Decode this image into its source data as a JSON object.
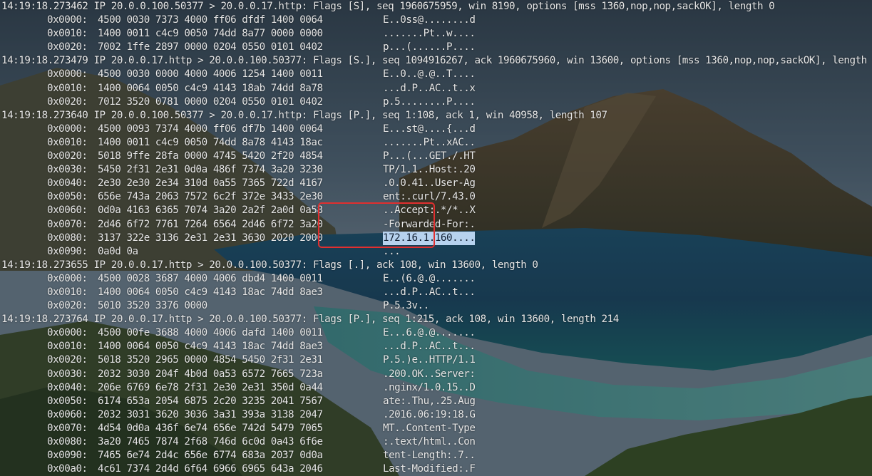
{
  "colors": {
    "text": "#e6e6e6",
    "selection": "#b7d2ee",
    "annotation_box": "#e12f2f"
  },
  "terminal": {
    "lines": [
      {
        "kind": "header",
        "text": "14:19:18.273462 IP 20.0.0.100.50377 > 20.0.0.17.http: Flags [S], seq 1960675959, win 8190, options [mss 1360,nop,nop,sackOK], length 0"
      },
      {
        "kind": "hex",
        "offset": "0x0000:",
        "words": "4500 0030 7373 4000 ff06 dfdf 1400 0064",
        "ascii": "E..0ss@........d"
      },
      {
        "kind": "hex",
        "offset": "0x0010:",
        "words": "1400 0011 c4c9 0050 74dd 8a77 0000 0000",
        "ascii": ".......Pt..w...."
      },
      {
        "kind": "hex",
        "offset": "0x0020:",
        "words": "7002 1ffe 2897 0000 0204 0550 0101 0402",
        "ascii": "p...(......P...."
      },
      {
        "kind": "header",
        "text": "14:19:18.273479 IP 20.0.0.17.http > 20.0.0.100.50377: Flags [S.], seq 1094916267, ack 1960675960, win 13600, options [mss 1360,nop,nop,sackOK], length 0"
      },
      {
        "kind": "hex",
        "offset": "0x0000:",
        "words": "4500 0030 0000 4000 4006 1254 1400 0011",
        "ascii": "E..0..@.@..T...."
      },
      {
        "kind": "hex",
        "offset": "0x0010:",
        "words": "1400 0064 0050 c4c9 4143 18ab 74dd 8a78",
        "ascii": "...d.P..AC..t..x"
      },
      {
        "kind": "hex",
        "offset": "0x0020:",
        "words": "7012 3520 0781 0000 0204 0550 0101 0402",
        "ascii": "p.5........P...."
      },
      {
        "kind": "header",
        "text": "14:19:18.273640 IP 20.0.0.100.50377 > 20.0.0.17.http: Flags [P.], seq 1:108, ack 1, win 40958, length 107"
      },
      {
        "kind": "hex",
        "offset": "0x0000:",
        "words": "4500 0093 7374 4000 ff06 df7b 1400 0064",
        "ascii": "E...st@....{...d"
      },
      {
        "kind": "hex",
        "offset": "0x0010:",
        "words": "1400 0011 c4c9 0050 74dd 8a78 4143 18ac",
        "ascii": ".......Pt..xAC.."
      },
      {
        "kind": "hex",
        "offset": "0x0020:",
        "words": "5018 9ffe 28fa 0000 4745 5420 2f20 4854",
        "ascii": "P...(...GET./.HT"
      },
      {
        "kind": "hex",
        "offset": "0x0030:",
        "words": "5450 2f31 2e31 0d0a 486f 7374 3a20 3230",
        "ascii": "TP/1.1..Host:.20"
      },
      {
        "kind": "hex",
        "offset": "0x0040:",
        "words": "2e30 2e30 2e34 310d 0a55 7365 722d 4167",
        "ascii": ".0.0.41..User-Ag"
      },
      {
        "kind": "hex",
        "offset": "0x0050:",
        "words": "656e 743a 2063 7572 6c2f 372e 3433 2e30",
        "ascii": "ent:.curl/7.43.0"
      },
      {
        "kind": "hex",
        "offset": "0x0060:",
        "words": "0d0a 4163 6365 7074 3a20 2a2f 2a0d 0a58",
        "ascii": "..Accept:.*/*..X"
      },
      {
        "kind": "hex",
        "offset": "0x0070:",
        "words": "2d46 6f72 7761 7264 6564 2d46 6f72 3a20",
        "ascii": "-Forwarded-For:."
      },
      {
        "kind": "hex",
        "offset": "0x0080:",
        "words": "3137 322e 3136 2e31 2e31 3630 2020 2000",
        "ascii": "172.16.1.160....",
        "selected": true
      },
      {
        "kind": "hex",
        "offset": "0x0090:",
        "words": "0a0d 0a",
        "ascii": "..."
      },
      {
        "kind": "header",
        "text": "14:19:18.273655 IP 20.0.0.17.http > 20.0.0.100.50377: Flags [.], ack 108, win 13600, length 0"
      },
      {
        "kind": "hex",
        "offset": "0x0000:",
        "words": "4500 0028 3687 4000 4006 dbd4 1400 0011",
        "ascii": "E..(6.@.@......."
      },
      {
        "kind": "hex",
        "offset": "0x0010:",
        "words": "1400 0064 0050 c4c9 4143 18ac 74dd 8ae3",
        "ascii": "...d.P..AC..t..."
      },
      {
        "kind": "hex",
        "offset": "0x0020:",
        "words": "5010 3520 3376 0000",
        "ascii": "P.5.3v.."
      },
      {
        "kind": "header",
        "text": "14:19:18.273764 IP 20.0.0.17.http > 20.0.0.100.50377: Flags [P.], seq 1:215, ack 108, win 13600, length 214"
      },
      {
        "kind": "hex",
        "offset": "0x0000:",
        "words": "4500 00fe 3688 4000 4006 dafd 1400 0011",
        "ascii": "E...6.@.@......."
      },
      {
        "kind": "hex",
        "offset": "0x0010:",
        "words": "1400 0064 0050 c4c9 4143 18ac 74dd 8ae3",
        "ascii": "...d.P..AC..t..."
      },
      {
        "kind": "hex",
        "offset": "0x0020:",
        "words": "5018 3520 2965 0000 4854 5450 2f31 2e31",
        "ascii": "P.5.)e..HTTP/1.1"
      },
      {
        "kind": "hex",
        "offset": "0x0030:",
        "words": "2032 3030 204f 4b0d 0a53 6572 7665 723a",
        "ascii": ".200.OK..Server:"
      },
      {
        "kind": "hex",
        "offset": "0x0040:",
        "words": "206e 6769 6e78 2f31 2e30 2e31 350d 0a44",
        "ascii": ".nginx/1.0.15..D"
      },
      {
        "kind": "hex",
        "offset": "0x0050:",
        "words": "6174 653a 2054 6875 2c20 3235 2041 7567",
        "ascii": "ate:.Thu,.25.Aug"
      },
      {
        "kind": "hex",
        "offset": "0x0060:",
        "words": "2032 3031 3620 3036 3a31 393a 3138 2047",
        "ascii": ".2016.06:19:18.G"
      },
      {
        "kind": "hex",
        "offset": "0x0070:",
        "words": "4d54 0d0a 436f 6e74 656e 742d 5479 7065",
        "ascii": "MT..Content-Type"
      },
      {
        "kind": "hex",
        "offset": "0x0080:",
        "words": "3a20 7465 7874 2f68 746d 6c0d 0a43 6f6e",
        "ascii": ":.text/html..Con"
      },
      {
        "kind": "hex",
        "offset": "0x0090:",
        "words": "7465 6e74 2d4c 656e 6774 683a 2037 0d0a",
        "ascii": "tent-Length:.7.."
      },
      {
        "kind": "hex",
        "offset": "0x00a0:",
        "words": "4c61 7374 2d4d 6f64 6966 6965 643a 2046",
        "ascii": "Last-Modified:.F"
      }
    ]
  }
}
